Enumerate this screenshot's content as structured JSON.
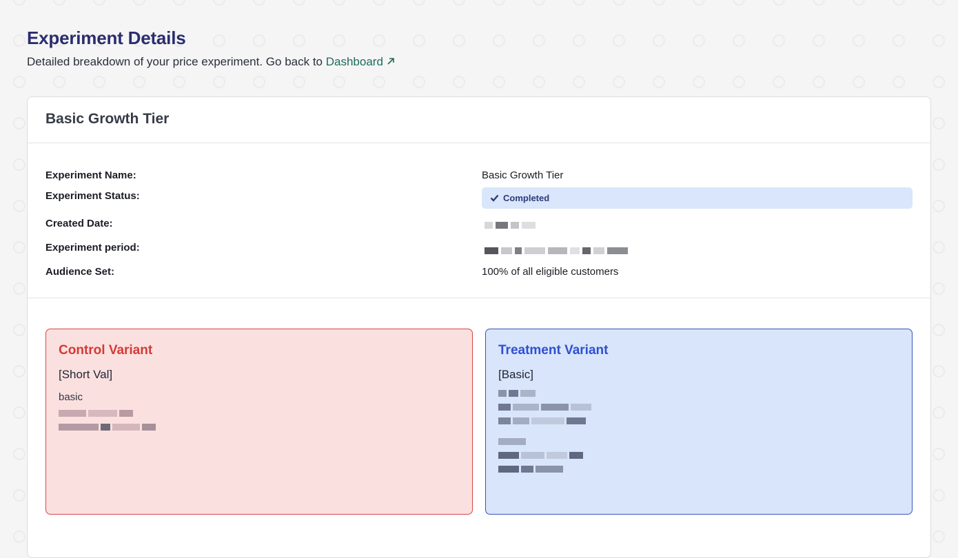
{
  "page": {
    "title": "Experiment Details",
    "subtitle": "Detailed breakdown of your price experiment. Go back to",
    "dashboard_link": "Dashboard",
    "dashboard_link_icon": "arrow-up-right-icon"
  },
  "card": {
    "title": "Basic Growth Tier",
    "details": {
      "name_label": "Experiment Name:",
      "name_value": "Basic Growth Tier",
      "status_label": "Experiment Status:",
      "status_value": "Completed",
      "status_icon": "check-icon",
      "created_label": "Created Date:",
      "period_label": "Experiment period:",
      "audience_label": "Audience Set:",
      "audience_value": "100% of all eligible customers"
    },
    "control": {
      "title": "Control Variant",
      "subtitle": "[Short Val]",
      "line1": "basic",
      "color": "#d33a34"
    },
    "treatment": {
      "title": "Treatment Variant",
      "subtitle": "[Basic]",
      "color": "#2f4fd0"
    }
  },
  "colors": {
    "heading": "#2b2d6e",
    "link": "#1d6b5a",
    "status_bg": "#d9e6fb",
    "control_bg": "#fbe0e0",
    "treatment_bg": "#d8e5fb"
  }
}
